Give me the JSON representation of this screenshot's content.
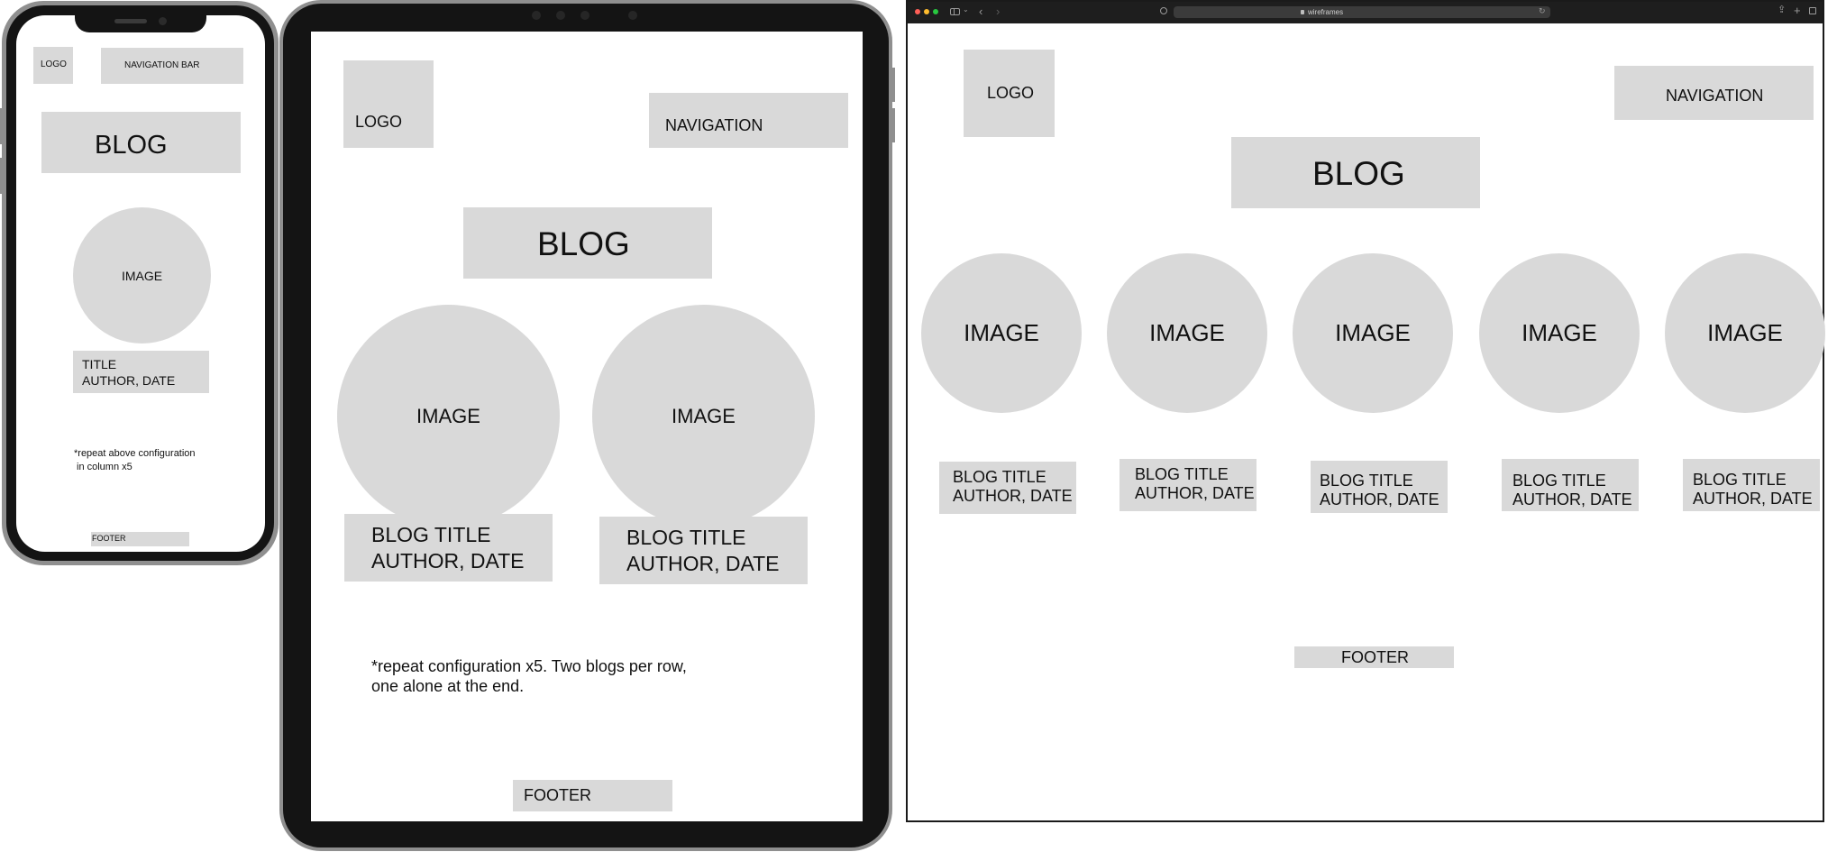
{
  "phone": {
    "logo": "LOGO",
    "navigation": "NAVIGATION BAR",
    "heading": "BLOG",
    "image": "IMAGE",
    "title": "TITLE",
    "author_date": "AUTHOR, DATE",
    "note_line1": "*repeat above configuration",
    "note_line2": "in column x5",
    "footer": "FOOTER"
  },
  "tablet": {
    "logo": "LOGO",
    "navigation": "NAVIGATION",
    "heading": "BLOG",
    "posts": [
      {
        "image": "IMAGE",
        "title": "BLOG TITLE",
        "author_date": "AUTHOR, DATE"
      },
      {
        "image": "IMAGE",
        "title": "BLOG TITLE",
        "author_date": "AUTHOR, DATE"
      }
    ],
    "note_line1": "*repeat configuration x5. Two blogs per row,",
    "note_line2": "one alone at the end.",
    "footer": "FOOTER"
  },
  "desktop": {
    "url": "wireframes",
    "logo": "LOGO",
    "navigation": "NAVIGATION",
    "heading": "BLOG",
    "posts": [
      {
        "image": "IMAGE",
        "title": "BLOG TITLE",
        "author_date": "AUTHOR, DATE"
      },
      {
        "image": "IMAGE",
        "title": "BLOG TITLE",
        "author_date": "AUTHOR, DATE"
      },
      {
        "image": "IMAGE",
        "title": "BLOG TITLE",
        "author_date": "AUTHOR, DATE"
      },
      {
        "image": "IMAGE",
        "title": "BLOG TITLE",
        "author_date": "AUTHOR, DATE"
      },
      {
        "image": "IMAGE",
        "title": "BLOG TITLE",
        "author_date": "AUTHOR, DATE"
      }
    ],
    "footer": "FOOTER"
  },
  "colors": {
    "placeholder": "#d9d9d9",
    "device_frame": "#141414",
    "device_edge": "#8f8f8f",
    "traffic_red": "#ff5f57",
    "traffic_yellow": "#febc2e",
    "traffic_green": "#28c840"
  },
  "icons": [
    "sidebar-icon",
    "back-icon",
    "forward-icon",
    "lock-icon",
    "reload-icon",
    "share-icon",
    "new-tab-icon",
    "tabs-overview-icon"
  ]
}
